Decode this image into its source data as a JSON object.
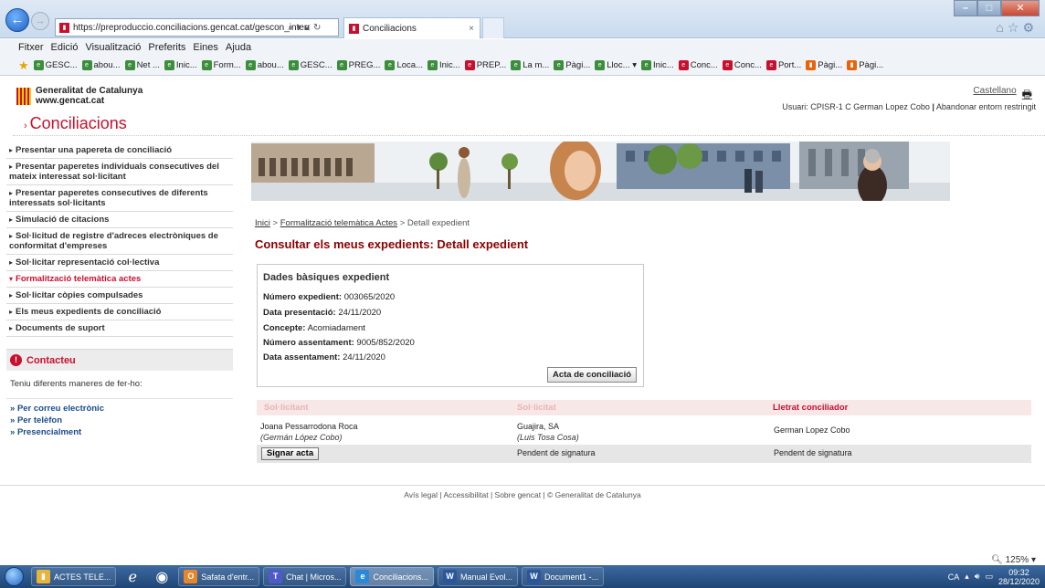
{
  "browser": {
    "url": "https://preproduccio.conciliacions.gencat.cat/gescon_interr",
    "tab_title": "Conciliacions",
    "menu": [
      "Fitxer",
      "Edició",
      "Visualització",
      "Preferits",
      "Eines",
      "Ajuda"
    ],
    "favorites": [
      {
        "label": "GESC...",
        "icon": "ie"
      },
      {
        "label": "abou...",
        "icon": "ie"
      },
      {
        "label": "Net ...",
        "icon": "ie"
      },
      {
        "label": "Inic...",
        "icon": "ie"
      },
      {
        "label": "Form...",
        "icon": "ie"
      },
      {
        "label": "abou...",
        "icon": "ie"
      },
      {
        "label": "GESC...",
        "icon": "ie"
      },
      {
        "label": "PREG...",
        "icon": "ie"
      },
      {
        "label": "Loca...",
        "icon": "ie"
      },
      {
        "label": "Inic...",
        "icon": "ie"
      },
      {
        "label": "PREP...",
        "icon": "gc"
      },
      {
        "label": "La m...",
        "icon": "ie"
      },
      {
        "label": "Pàgi...",
        "icon": "ie"
      },
      {
        "label": "Lloc... ▾",
        "icon": "ie"
      },
      {
        "label": "Inic...",
        "icon": "ie"
      },
      {
        "label": "Conc...",
        "icon": "gc"
      },
      {
        "label": "Conc...",
        "icon": "gc"
      },
      {
        "label": "Port...",
        "icon": "gc"
      },
      {
        "label": "Pàgi...",
        "icon": "or"
      },
      {
        "label": "Pàgi...",
        "icon": "or"
      }
    ]
  },
  "header": {
    "logo_line1": "Generalitat de Catalunya",
    "logo_line2": "www.gencat.cat",
    "language_link": "Castellano",
    "user_label": "Usuari: CPISR-1 C German Lopez Cobo",
    "exit_link": "Abandonar entorn restringit",
    "site_title": "Conciliacions",
    "site_title_prefix": "›"
  },
  "sidebar": {
    "items": [
      {
        "label": "Presentar una papereta de conciliació",
        "active": false
      },
      {
        "label": "Presentar paperetes individuals consecutives del mateix interessat sol·licitant",
        "active": false
      },
      {
        "label": "Presentar paperetes consecutives de diferents interessats sol·licitants",
        "active": false
      },
      {
        "label": "Simulació de citacions",
        "active": false
      },
      {
        "label": "Sol·licitud de registre d'adreces electròniques de conformitat d'empreses",
        "active": false
      },
      {
        "label": "Sol·licitar representació col·lectiva",
        "active": false
      },
      {
        "label": "Formalització telemàtica actes",
        "active": true
      },
      {
        "label": "Sol·licitar còpies compulsades",
        "active": false
      },
      {
        "label": "Els meus expedients de conciliació",
        "active": false
      },
      {
        "label": "Documents de suport",
        "active": false
      }
    ],
    "contact": {
      "title": "Contacteu",
      "intro": "Teniu diferents maneres de fer-ho:",
      "links": [
        "Per correu electrònic",
        "Per telèfon",
        "Presencialment"
      ]
    }
  },
  "breadcrumb": {
    "home": "Inici",
    "section": "Formalització telemàtica Actes",
    "current": "Detall expedient",
    "separator": ">"
  },
  "main": {
    "title": "Consultar els meus expedients: Detall expedient",
    "details": {
      "title": "Dades bàsiques expedient",
      "rows": [
        {
          "label": "Número expedient:",
          "value": "003065/2020"
        },
        {
          "label": "Data presentació:",
          "value": "24/11/2020"
        },
        {
          "label": "Concepte:",
          "value": "Acomiadament"
        },
        {
          "label": "Número assentament:",
          "value": "9005/852/2020"
        },
        {
          "label": "Data assentament:",
          "value": "24/11/2020"
        }
      ],
      "button": "Acta de conciliació"
    },
    "table": {
      "headers": [
        "Sol·licitant",
        "Sol·licitat",
        "Lletrat conciliador"
      ],
      "row": {
        "c1_name": "Joana Pessarrodona Roca",
        "c1_sub": "(Germán López Cobo)",
        "c2_name": "Guajira, SA",
        "c2_sub": "(Luis Tosa Cosa)",
        "c3_name": "German Lopez Cobo"
      },
      "status_row": {
        "button": "Signar acta",
        "c2": "Pendent de signatura",
        "c3": "Pendent de signatura"
      }
    }
  },
  "footer": {
    "links": [
      "Avís legal",
      "Accessibilitat",
      "Sobre gencat",
      "© Generalitat de Catalunya"
    ]
  },
  "status": {
    "zoom": "125%"
  },
  "taskbar": {
    "items": [
      {
        "label": "ACTES TELE...",
        "color": "#e8b43a",
        "glyph": "▮"
      },
      {
        "label": "Safata d'entr...",
        "color": "#e6852a",
        "glyph": "O"
      },
      {
        "label": "Chat | Micros...",
        "color": "#5059c9",
        "glyph": "T"
      },
      {
        "label": "Conciliacions...",
        "color": "#2b88d8",
        "glyph": "e"
      },
      {
        "label": "Manual Evol...",
        "color": "#2b579a",
        "glyph": "W"
      },
      {
        "label": "Document1 -...",
        "color": "#2b579a",
        "glyph": "W"
      }
    ],
    "lang": "CA",
    "time": "09:32",
    "date": "28/12/2020"
  }
}
